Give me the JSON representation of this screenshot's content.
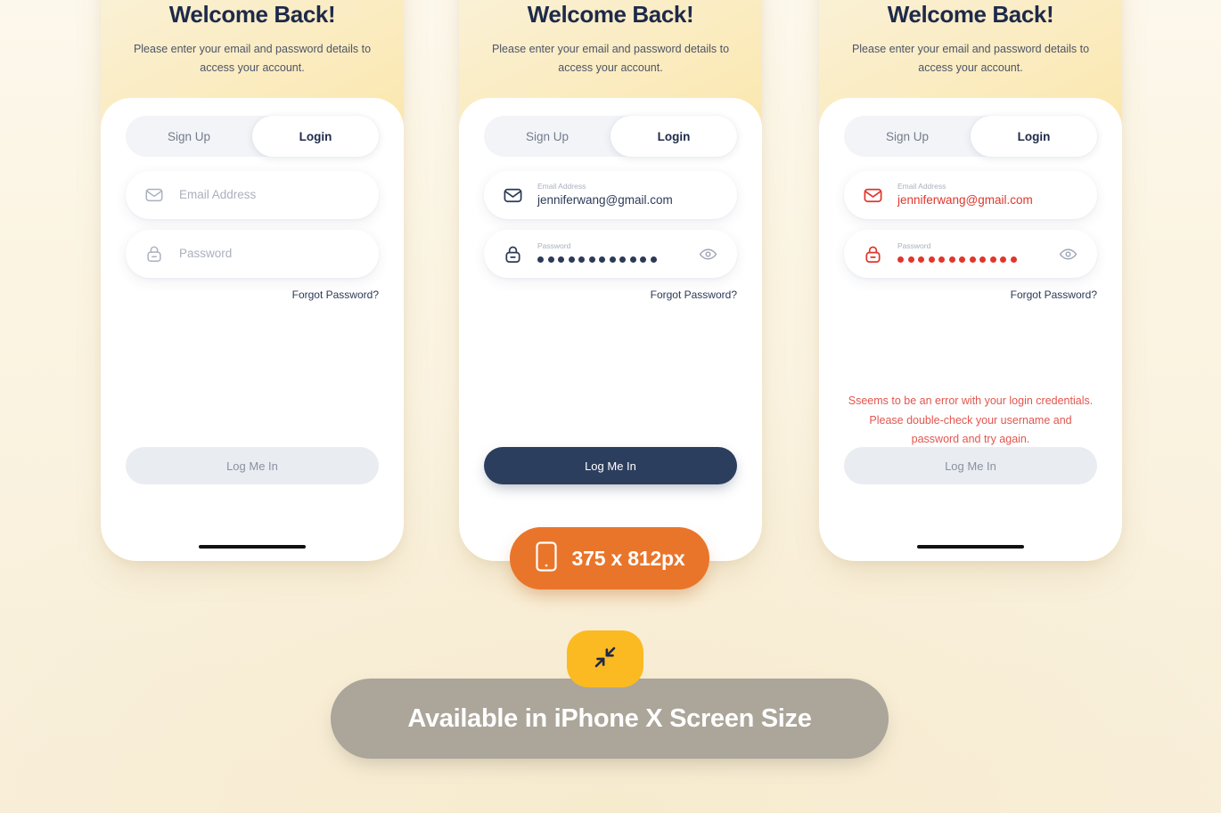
{
  "background_color": "#FBF4E2",
  "accent": {
    "navy": "#2C3E5D",
    "orange": "#E9752B",
    "yellow": "#FBBA21",
    "error_red": "#E0362C",
    "error_text": "#E2564E",
    "banner_gray": "#ABA59A"
  },
  "screens": [
    {
      "state": "empty",
      "title": "Welcome Back!",
      "subtitle": "Please enter your email and password details to access your account.",
      "toggle": {
        "signup_label": "Sign Up",
        "login_label": "Login",
        "selected": "Login"
      },
      "email": {
        "icon": "envelope-icon",
        "label": "",
        "placeholder": "Email Address",
        "value": ""
      },
      "password": {
        "icon": "lock-icon",
        "label": "",
        "placeholder": "Password",
        "value": "",
        "dot_count": 0,
        "eye_icon": "eye-icon",
        "eye_visible": false
      },
      "forgot_label": "Forgot Password?",
      "error_message": "",
      "cta_label": "Log Me In",
      "cta_enabled": false
    },
    {
      "state": "filled",
      "title": "Welcome Back!",
      "subtitle": "Please enter your email and password details to access your account.",
      "toggle": {
        "signup_label": "Sign Up",
        "login_label": "Login",
        "selected": "Login"
      },
      "email": {
        "icon": "envelope-icon",
        "label": "Email Address",
        "placeholder": "Email Address",
        "value": "jenniferwang@gmail.com"
      },
      "password": {
        "icon": "lock-icon",
        "label": "Password",
        "placeholder": "Password",
        "value": "",
        "dot_count": 12,
        "eye_icon": "eye-icon",
        "eye_visible": true
      },
      "forgot_label": "Forgot Password?",
      "error_message": "",
      "cta_label": "Log Me In",
      "cta_enabled": true
    },
    {
      "state": "error",
      "title": "Welcome Back!",
      "subtitle": "Please enter your email and password details to access your account.",
      "toggle": {
        "signup_label": "Sign Up",
        "login_label": "Login",
        "selected": "Login"
      },
      "email": {
        "icon": "envelope-icon",
        "label": "Email Address",
        "placeholder": "Email Address",
        "value": "jenniferwang@gmail.com"
      },
      "password": {
        "icon": "lock-icon",
        "label": "Password",
        "placeholder": "Password",
        "value": "",
        "dot_count": 12,
        "eye_icon": "eye-icon",
        "eye_visible": true
      },
      "forgot_label": "Forgot Password?",
      "error_message": "Sseems to be an error with your login credentials. Please double-check your username and password and try again.",
      "cta_label": "Log Me In",
      "cta_enabled": false
    }
  ],
  "size_badge": {
    "icon": "mobile-phone-icon",
    "label": "375 x 812px"
  },
  "resize_chip": {
    "icon": "resize-collapse-arrows-icon"
  },
  "banner": {
    "label": "Available in iPhone X Screen Size"
  }
}
